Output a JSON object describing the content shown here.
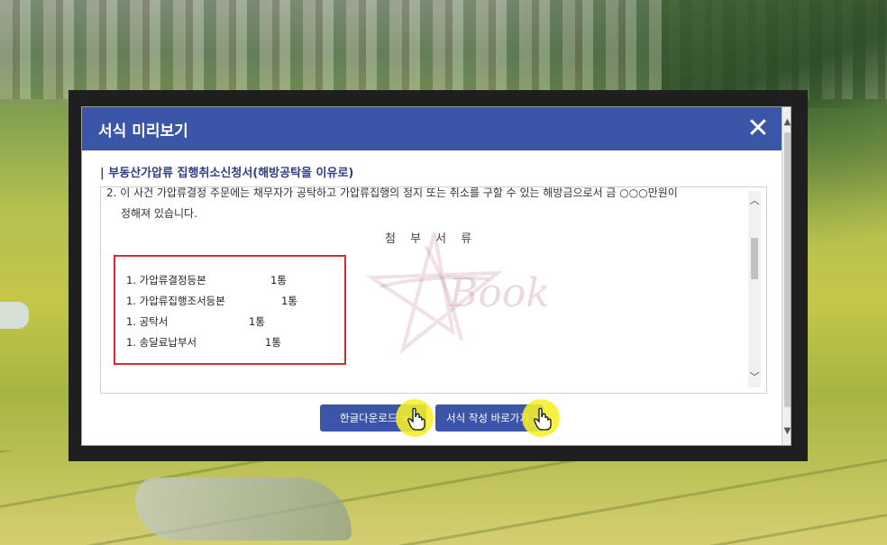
{
  "dialog": {
    "title": "서식 미리보기",
    "close_symbol": "✕"
  },
  "form": {
    "title": "| 부동산가압류 집행취소신청서(해방공탁을 이유로)"
  },
  "document": {
    "paragraph_partial": "2. 이 사건 가압류결정 주문에는 채무자가 공탁하고 가압류집행의 정지 또는 취소를 구할 수 있는 해방금으로서 금 ○○○만원이",
    "paragraph_continued": "정해져 있습니다.",
    "attachments_heading": "첨 부 서 류",
    "attachments": [
      {
        "name": "1. 가압류결정등본",
        "count": "1통"
      },
      {
        "name": "1. 가압류집행조서등본",
        "count": "1통"
      },
      {
        "name": "1. 공탁서",
        "count": "1통"
      },
      {
        "name": "1. 송달료납부서",
        "count": "1통"
      }
    ],
    "watermark_text": "Book"
  },
  "buttons": {
    "download_hwp": "한글다운로드",
    "go_to_form": "서식 작성 바로가기",
    "arrow": ">"
  },
  "icons": {
    "close": "close-icon",
    "scroll_up": "chevron-up-icon",
    "scroll_down": "chevron-down-icon",
    "cursor": "hand-pointer-icon"
  },
  "colors": {
    "header": "#3b55a9",
    "button": "#3d55a8",
    "form_title": "#2e3f88",
    "attach_border": "#d42b2b",
    "highlight": "#f6f028"
  }
}
